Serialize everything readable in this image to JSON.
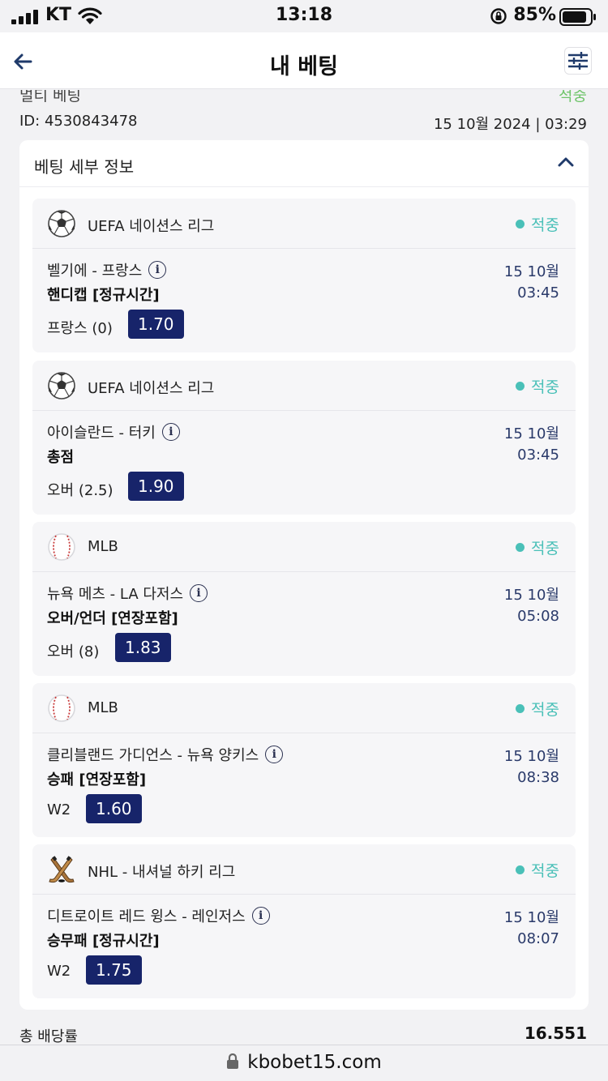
{
  "status_bar": {
    "carrier": "KT",
    "time": "13:18",
    "battery": "85%"
  },
  "nav": {
    "title": "내 베팅"
  },
  "summary": {
    "type_label": "멀티 베팅",
    "status": "적중",
    "id_text": "ID: 4530843478",
    "date_text": "15 10월 2024 | 03:29"
  },
  "details": {
    "header_label": "베팅 세부 정보",
    "legs": [
      {
        "sport_icon": "soccer-ball-icon",
        "league": "UEFA 네이션스 리그",
        "result": "적중",
        "match": "벨기에 - 프랑스",
        "market": "핸디캡 [정규시간]",
        "selection": "프랑스 (0)",
        "odds": "1.70",
        "date": "15 10월",
        "time": "03:45"
      },
      {
        "sport_icon": "soccer-ball-icon",
        "league": "UEFA 네이션스 리그",
        "result": "적중",
        "match": "아이슬란드 - 터키",
        "market": "총점",
        "selection": "오버 (2.5)",
        "odds": "1.90",
        "date": "15 10월",
        "time": "03:45"
      },
      {
        "sport_icon": "baseball-icon",
        "league": "MLB",
        "result": "적중",
        "match": "뉴욕 메츠 - LA 다저스",
        "market": "오버/언더 [연장포함]",
        "selection": "오버 (8)",
        "odds": "1.83",
        "date": "15 10월",
        "time": "05:08"
      },
      {
        "sport_icon": "baseball-icon",
        "league": "MLB",
        "result": "적중",
        "match": "클리블랜드 가디언스 - 뉴욕 양키스",
        "market": "승패 [연장포함]",
        "selection": "W2",
        "odds": "1.60",
        "date": "15 10월",
        "time": "08:38"
      },
      {
        "sport_icon": "hockey-sticks-icon",
        "league": "NHL - 내셔널 하키 리그",
        "result": "적중",
        "match": "디트로이트 레드 윙스 - 레인저스",
        "market": "승무패 [정규시간]",
        "selection": "W2",
        "odds": "1.75",
        "date": "15 10월",
        "time": "08:07"
      }
    ]
  },
  "total": {
    "label": "총 배당률",
    "value": "16.551"
  },
  "url_bar": {
    "url": "kbobet15.com"
  }
}
